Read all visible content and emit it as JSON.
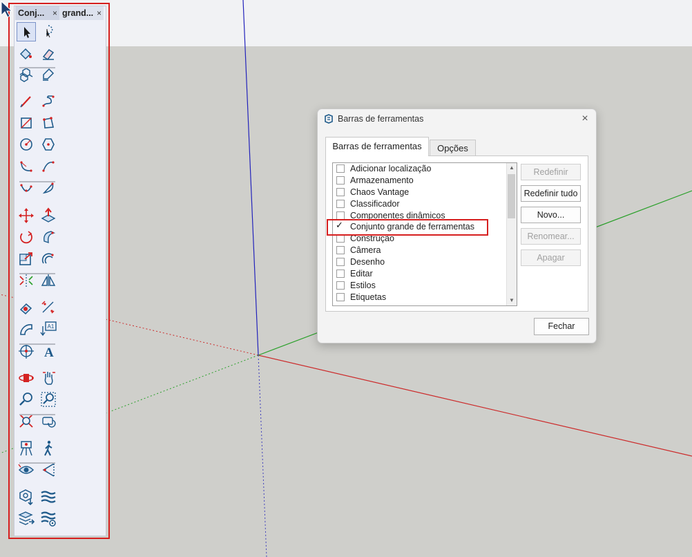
{
  "toolbar_panel": {
    "tabs": [
      {
        "label": "Conj...",
        "close": "×"
      },
      {
        "label": "grand...",
        "close": "×"
      }
    ],
    "tools": [
      [
        "select-icon",
        "lasso-select-icon"
      ],
      [
        "paint-bucket-icon",
        "eraser-icon"
      ],
      [
        "make-component-icon",
        "tag-icon"
      ],
      [
        "line-icon",
        "freehand-icon"
      ],
      [
        "rectangle-icon",
        "rotated-rectangle-icon"
      ],
      [
        "circle-icon",
        "polygon-icon"
      ],
      [
        "arc-icon",
        "two-point-arc-icon"
      ],
      [
        "three-point-arc-icon",
        "pie-icon"
      ],
      [
        "move-icon",
        "push-pull-icon"
      ],
      [
        "rotate-icon",
        "follow-me-icon"
      ],
      [
        "scale-icon",
        "offset-icon"
      ],
      [
        "flip-icon",
        "mirror-icon"
      ],
      [
        "tape-measure-icon",
        "dimension-icon"
      ],
      [
        "protractor-icon",
        "text-label-icon"
      ],
      [
        "axes-icon",
        "3d-text-icon"
      ],
      [
        "orbit-icon",
        "pan-icon"
      ],
      [
        "zoom-icon",
        "zoom-window-icon"
      ],
      [
        "zoom-extents-icon",
        "previous-view-icon"
      ],
      [
        "position-camera-icon",
        "walk-icon"
      ],
      [
        "look-around-icon",
        "section-plane-icon"
      ],
      [
        "component-download-icon",
        "extension-warehouse-icon"
      ],
      [
        "layers-export-icon",
        "extension-manager-icon"
      ]
    ]
  },
  "dialog": {
    "title": "Barras de ferramentas",
    "close": "×",
    "tabs": [
      "Barras de ferramentas",
      "Opções"
    ],
    "items": [
      {
        "label": "Adicionar localização",
        "checked": false
      },
      {
        "label": "Armazenamento",
        "checked": false
      },
      {
        "label": "Chaos Vantage",
        "checked": false
      },
      {
        "label": "Classificador",
        "checked": false
      },
      {
        "label": "Componentes dinâmicos",
        "checked": false
      },
      {
        "label": "Conjunto grande de ferramentas",
        "checked": true
      },
      {
        "label": "Construção",
        "checked": false
      },
      {
        "label": "Câmera",
        "checked": false
      },
      {
        "label": "Desenho",
        "checked": false
      },
      {
        "label": "Editar",
        "checked": false
      },
      {
        "label": "Estilos",
        "checked": false
      },
      {
        "label": "Etiquetas",
        "checked": false
      }
    ],
    "buttons": [
      {
        "label": "Redefinir",
        "enabled": false
      },
      {
        "label": "Redefinir tudo",
        "enabled": true
      },
      {
        "label": "Novo...",
        "enabled": true
      },
      {
        "label": "Renomear...",
        "enabled": false
      },
      {
        "label": "Apagar",
        "enabled": false
      }
    ],
    "close_button": "Fechar"
  },
  "colors": {
    "highlight": "#d61f1f",
    "icon_blue": "#1e5a8a",
    "icon_red": "#d42323",
    "axis_red": "#cc2a2a",
    "axis_green": "#2aa02a",
    "axis_blue": "#2222bb"
  }
}
